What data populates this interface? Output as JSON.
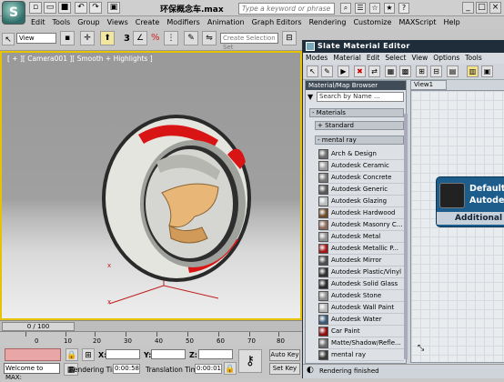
{
  "titlebar": {
    "doc_title": "环保概念车.max",
    "search_placeholder": "Type a keyword or phrase",
    "logo_text": "S"
  },
  "menu": [
    "Edit",
    "Tools",
    "Group",
    "Views",
    "Create",
    "Modifiers",
    "Animation",
    "Graph Editors",
    "Rendering",
    "Customize",
    "MAXScript",
    "Help"
  ],
  "toolbar": {
    "view_select": "View",
    "selection_set_placeholder": "Create Selection Set",
    "num3": "3",
    "percent": "%"
  },
  "viewport": {
    "label": "[ + ][ Camera001 ][ Smooth + Highlights ]"
  },
  "timeline": {
    "frame": "0 / 100",
    "ticks": [
      "0",
      "10",
      "20",
      "30",
      "40",
      "50",
      "60",
      "70",
      "80"
    ]
  },
  "status": {
    "listener": "Welcome to MAX:",
    "x_label": "X:",
    "y_label": "Y:",
    "z_label": "Z:",
    "rendering_time_label": "Rendering Time",
    "rendering_time_value": "0:00:58",
    "translation_time_label": "Translation Time",
    "translation_time_value": "0:00:01",
    "auto_key": "Auto Key",
    "set_key": "Set Key"
  },
  "slate": {
    "title": "Slate Material Editor",
    "menu": [
      "Modes",
      "Material",
      "Edit",
      "Select",
      "View",
      "Options",
      "Tools"
    ],
    "browser_title": "Material/Map Browser",
    "search_placeholder": "Search by Name ...",
    "groups": {
      "materials": "- Materials",
      "standard": "+ Standard",
      "mental_ray": "- mental ray"
    },
    "materials": [
      {
        "name": "Arch & Design",
        "color": "#6b6b6b"
      },
      {
        "name": "Autodesk Ceramic",
        "color": "#9a9a9a"
      },
      {
        "name": "Autodesk Concrete",
        "color": "#777777"
      },
      {
        "name": "Autodesk Generic",
        "color": "#5a5a5a"
      },
      {
        "name": "Autodesk Glazing",
        "color": "#b8bcbf"
      },
      {
        "name": "Autodesk Hardwood",
        "color": "#6e4a2a"
      },
      {
        "name": "Autodesk Masonry C...",
        "color": "#8a6a5a"
      },
      {
        "name": "Autodesk Metal",
        "color": "#8f8f8f"
      },
      {
        "name": "Autodesk Metallic P...",
        "color": "#a01818"
      },
      {
        "name": "Autodesk Mirror",
        "color": "#4d4d4d"
      },
      {
        "name": "Autodesk Plastic/Vinyl",
        "color": "#303030"
      },
      {
        "name": "Autodesk Solid Glass",
        "color": "#2b2b2b"
      },
      {
        "name": "Autodesk Stone",
        "color": "#8c8c8c"
      },
      {
        "name": "Autodesk Wall Paint",
        "color": "#b5b5b5"
      },
      {
        "name": "Autodesk Water",
        "color": "#3c5a78"
      },
      {
        "name": "Car Paint",
        "color": "#8a1010"
      },
      {
        "name": "Matte/Shadow/Refle...",
        "color": "#6a6a6a"
      },
      {
        "name": "mental ray",
        "color": "#3a3a3a"
      }
    ],
    "view_tab": "View1",
    "node_title_1": "Default",
    "node_title_2": "Autode",
    "node_param": "Additional P",
    "status": "Rendering finished"
  }
}
